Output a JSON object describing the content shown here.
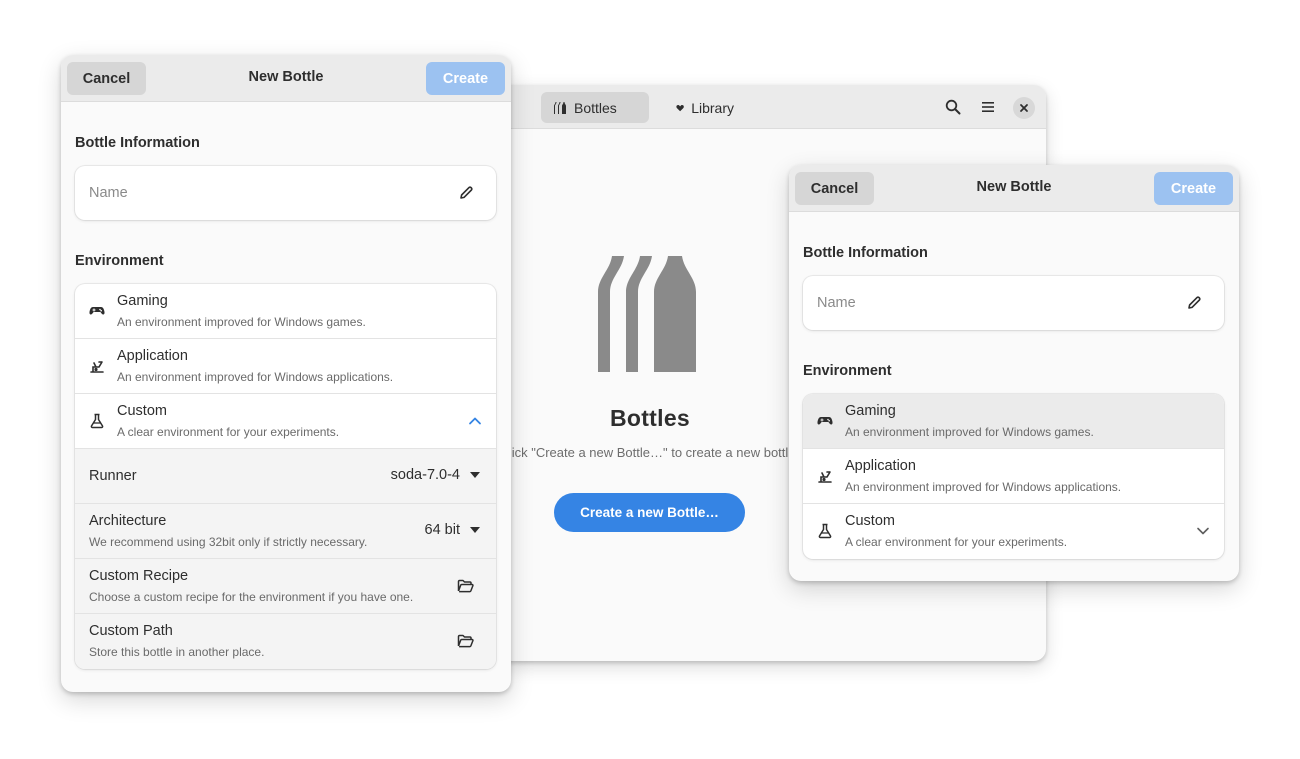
{
  "main_window": {
    "tabs": [
      {
        "label": "Bottles",
        "icon": "bottles-icon",
        "active": true
      },
      {
        "label": "Library",
        "icon": "heart-icon",
        "active": false
      }
    ],
    "empty_state": {
      "title": "Bottles",
      "description": "ick \"Create a new Bottle…\" to create a new bottl",
      "button": "Create a new Bottle…"
    },
    "header_icons": [
      "search-icon",
      "hamburger-menu-icon",
      "close-icon"
    ]
  },
  "dialog_left": {
    "cancel": "Cancel",
    "title": "New Bottle",
    "create": "Create",
    "bottle_info_title": "Bottle Information",
    "name_placeholder": "Name",
    "environment_title": "Environment",
    "environments": [
      {
        "title": "Gaming",
        "subtitle": "An environment improved for Windows games.",
        "icon": "gamepad-icon"
      },
      {
        "title": "Application",
        "subtitle": "An environment improved for Windows applications.",
        "icon": "application-icon"
      },
      {
        "title": "Custom",
        "subtitle": "A clear environment for your experiments.",
        "icon": "flask-icon",
        "expanded": true
      }
    ],
    "custom_options": {
      "runner_label": "Runner",
      "runner_value": "soda-7.0-4",
      "architecture_label": "Architecture",
      "architecture_subtitle": "We recommend using 32bit only if strictly necessary.",
      "architecture_value": "64 bit",
      "recipe_label": "Custom Recipe",
      "recipe_subtitle": "Choose a custom recipe for the environment if you have one.",
      "path_label": "Custom Path",
      "path_subtitle": "Store this bottle in another place."
    }
  },
  "dialog_right": {
    "cancel": "Cancel",
    "title": "New Bottle",
    "create": "Create",
    "bottle_info_title": "Bottle Information",
    "name_placeholder": "Name",
    "environment_title": "Environment",
    "environments": [
      {
        "title": "Gaming",
        "subtitle": "An environment improved for Windows games.",
        "icon": "gamepad-icon",
        "highlighted": true
      },
      {
        "title": "Application",
        "subtitle": "An environment improved for Windows applications.",
        "icon": "application-icon"
      },
      {
        "title": "Custom",
        "subtitle": "A clear environment for your experiments.",
        "icon": "flask-icon",
        "expanded": false
      }
    ]
  },
  "colors": {
    "accent": "#3584e4",
    "accent_disabled": "#9cc2f1",
    "header_bg": "#ebebeb",
    "window_bg": "#fafafa"
  }
}
